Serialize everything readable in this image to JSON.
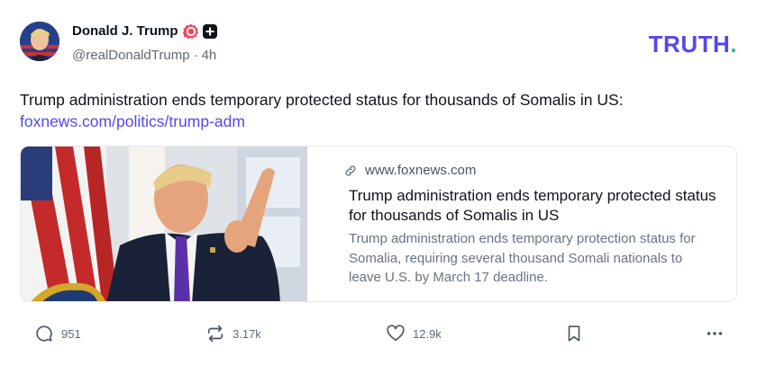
{
  "author": {
    "display_name": "Donald J. Trump",
    "handle": "@realDonaldTrump",
    "separator": "·",
    "time_ago": "4h"
  },
  "brand": {
    "logo_text": "TRUTH",
    "logo_dot": "."
  },
  "post": {
    "text": "Trump administration ends temporary protected status for thousands of Somalis in US:",
    "link_text": "foxnews.com/politics/trump-adm"
  },
  "link_card": {
    "domain": "www.foxnews.com",
    "title": "Trump administration ends temporary protected status for thousands of Somalis in US",
    "description": "Trump administration ends temporary protection status for Somalia, requiring several thousand Somali nationals to leave U.S. by March 17 deadline."
  },
  "actions": {
    "replies": "951",
    "retruths": "3.17k",
    "likes": "12.9k"
  },
  "colors": {
    "brand": "#5448ee",
    "verified": "#ee4b63",
    "text": "#0f1419",
    "muted": "#606a77"
  },
  "icons": {
    "verified": "verified-badge-icon",
    "plus": "plus-badge-icon",
    "link": "link-icon",
    "reply": "comment-icon",
    "retruth": "retruth-icon",
    "like": "heart-icon",
    "bookmark": "bookmark-icon",
    "more": "more-icon"
  }
}
